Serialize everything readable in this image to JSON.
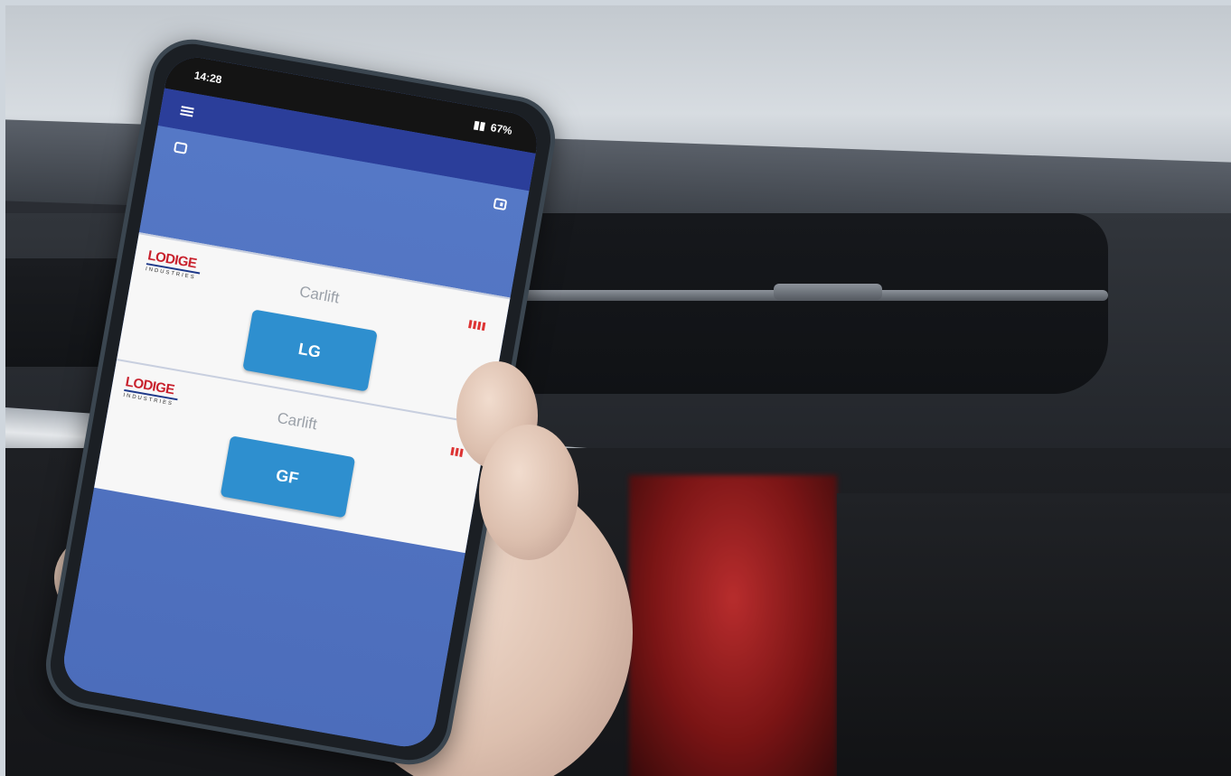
{
  "status_bar": {
    "time": "14:28",
    "battery": "67%"
  },
  "lifts": [
    {
      "logo_main": "LODIGE",
      "logo_sub": "INDUSTRIES",
      "title": "Carlift",
      "button_label": "LG"
    },
    {
      "logo_main": "LODIGE",
      "logo_sub": "INDUSTRIES",
      "title": "Carlift",
      "button_label": "GF"
    }
  ],
  "icons": {
    "menu": "menu-icon",
    "left_corner": "window-icon",
    "right_corner": "exit-icon",
    "signal": "signal-strength-icon"
  },
  "colors": {
    "app_bar": "#2b3e9a",
    "background": "#5578c6",
    "button": "#2e8fcf",
    "logo_red": "#c8202c"
  }
}
